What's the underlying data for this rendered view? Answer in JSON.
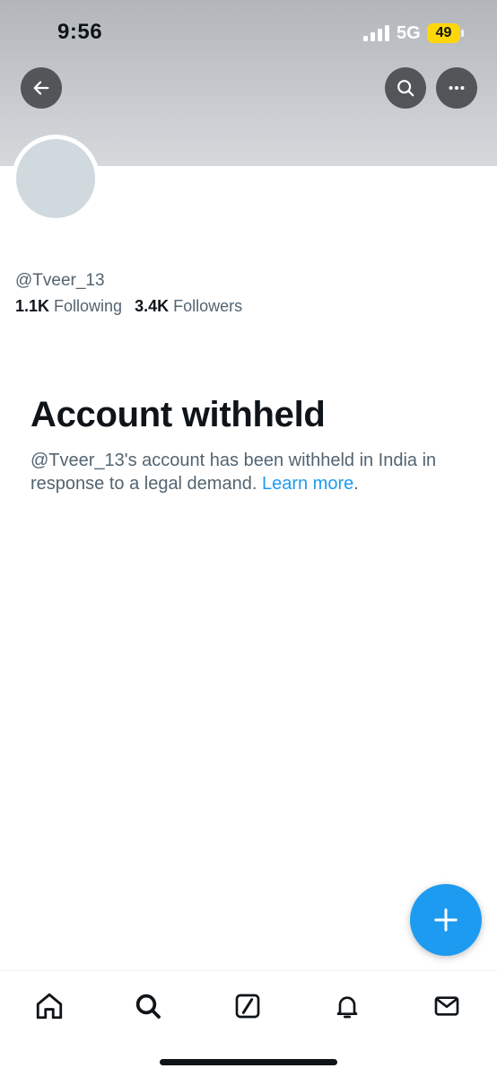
{
  "status_bar": {
    "time": "9:56",
    "network": "5G",
    "battery": "49",
    "battery_color": "#ffd60a"
  },
  "header": {
    "back_icon": "arrow-left-icon",
    "search_icon": "search-icon",
    "more_icon": "more-horizontal-icon"
  },
  "profile": {
    "handle": "@Tveer_13",
    "following_count": "1.1K",
    "following_label": "Following",
    "followers_count": "3.4K",
    "followers_label": "Followers"
  },
  "notice": {
    "title": "Account withheld",
    "body_text": "@Tveer_13's account has been withheld in India in response to a legal demand.",
    "learn_more": "Learn more",
    "trailing_period": "."
  },
  "fab": {
    "icon": "plus-icon",
    "color": "#1d9bf0"
  },
  "bottom_nav": {
    "items": [
      {
        "name": "home",
        "icon": "home-icon"
      },
      {
        "name": "search",
        "icon": "search-icon"
      },
      {
        "name": "grok",
        "icon": "grok-icon"
      },
      {
        "name": "notifications",
        "icon": "bell-icon"
      },
      {
        "name": "messages",
        "icon": "envelope-icon"
      }
    ]
  },
  "colors": {
    "accent": "#1d9bf0",
    "text_primary": "#0f1419",
    "text_secondary": "#536471"
  }
}
